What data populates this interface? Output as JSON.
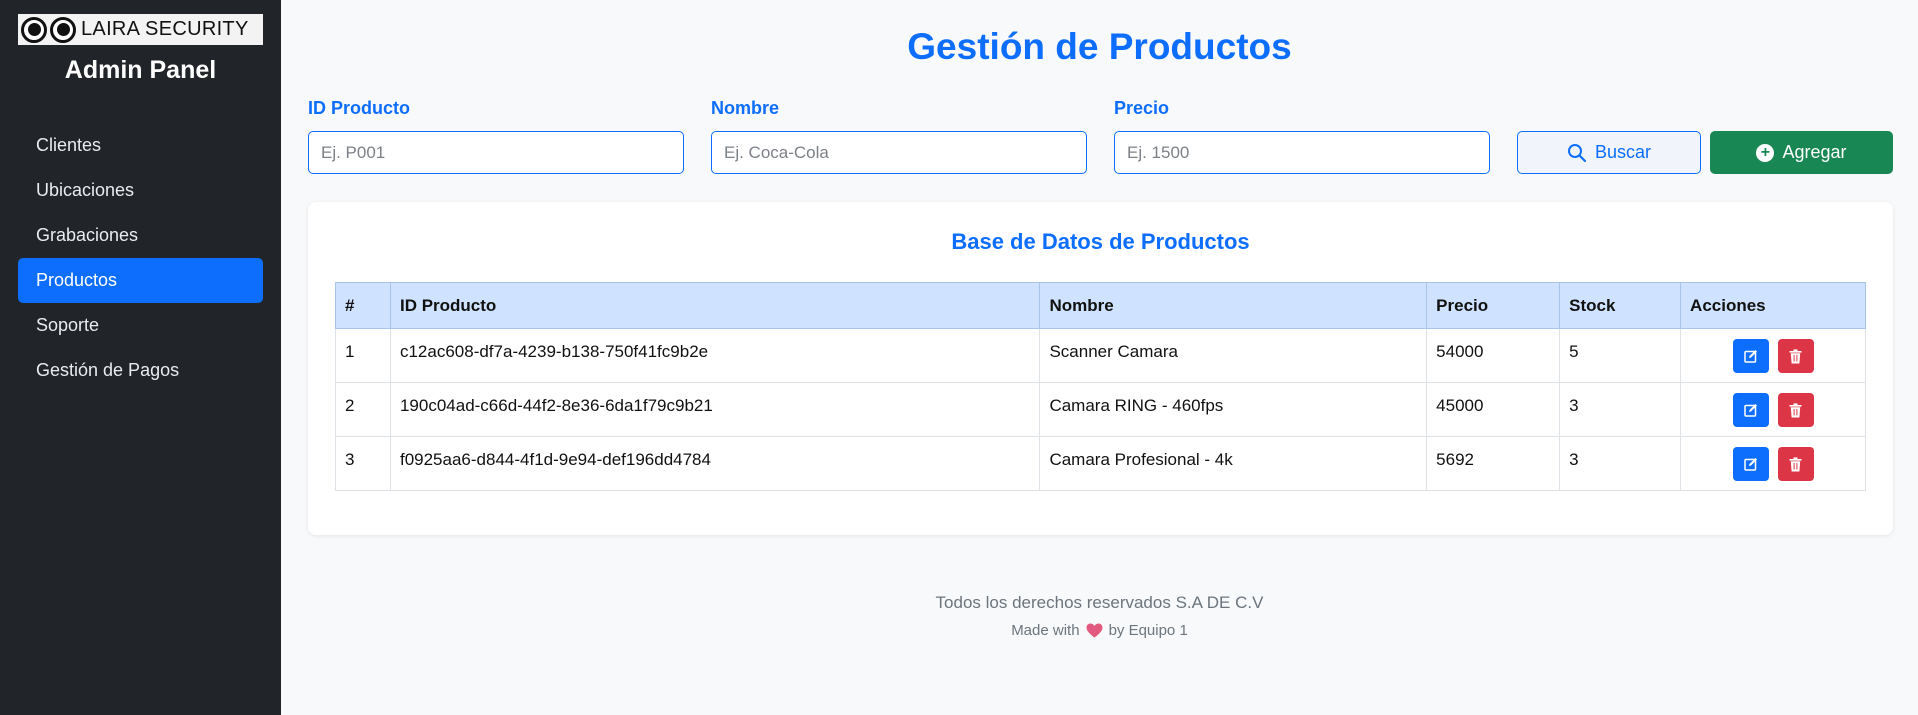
{
  "sidebar": {
    "logo_text": "LAIRA SECURITY",
    "panel_title": "Admin Panel",
    "items": [
      {
        "label": "Clientes"
      },
      {
        "label": "Ubicaciones"
      },
      {
        "label": "Grabaciones"
      },
      {
        "label": "Productos"
      },
      {
        "label": "Soporte"
      },
      {
        "label": "Gestión de Pagos"
      }
    ]
  },
  "header": {
    "title": "Gestión de Productos"
  },
  "form": {
    "id_label": "ID Producto",
    "id_placeholder": "Ej. P001",
    "id_value": "",
    "nombre_label": "Nombre",
    "nombre_placeholder": "Ej. Coca-Cola",
    "nombre_value": "",
    "precio_label": "Precio",
    "precio_placeholder": "Ej. 1500",
    "precio_value": "",
    "buscar_label": "Buscar",
    "agregar_label": "Agregar"
  },
  "table": {
    "title": "Base de Datos de Productos",
    "headers": [
      "#",
      "ID Producto",
      "Nombre",
      "Precio",
      "Stock",
      "Acciones"
    ],
    "rows": [
      [
        "1",
        "c12ac608-df7a-4239-b138-750f41fc9b2e",
        "Scanner Camara",
        "54000",
        "5"
      ],
      [
        "2",
        "190c04ad-c66d-44f2-8e36-6da1f79c9b21",
        "Camara RING - 460fps",
        "45000",
        "3"
      ],
      [
        "3",
        "f0925aa6-d844-4f1d-9e94-def196dd4784",
        "Camara Profesional - 4k",
        "5692",
        "3"
      ]
    ]
  },
  "footer": {
    "rights": "Todos los derechos reservados S.A DE C.V",
    "made_with": "Made with",
    "by": "by Equipo 1"
  },
  "colors": {
    "primary": "#0d6efd",
    "success": "#198754",
    "danger": "#dc3545",
    "sidebar_bg": "#212529",
    "table_header_bg": "#cfe2ff"
  },
  "icons": {
    "buscar": "search-icon",
    "agregar": "plus-circle-icon",
    "edit": "edit-icon",
    "delete": "trash-icon",
    "heart": "heart-icon"
  }
}
